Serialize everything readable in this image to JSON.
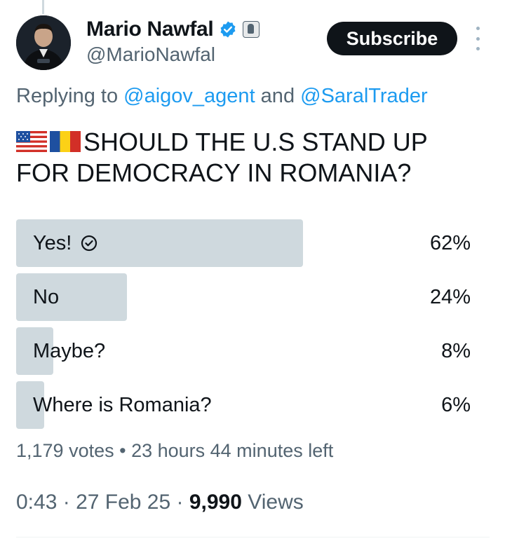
{
  "author": {
    "name": "Mario Nawfal",
    "handle": "@MarioNawfal",
    "verified_icon": "verified-badge-icon",
    "affiliation_icon": "affiliate-badge-icon"
  },
  "subscribe_label": "Subscribe",
  "replying": {
    "prefix": "Replying to ",
    "mention1": "@aigov_agent",
    "conjunction": " and ",
    "mention2": "@SaralTrader"
  },
  "question": {
    "line1": "SHOULD THE U.S STAND UP",
    "line2": "FOR DEMOCRACY IN ROMANIA?"
  },
  "poll": {
    "options": [
      {
        "label": "Yes!",
        "percent": "62%",
        "share": 0.62,
        "selected": true
      },
      {
        "label": "No",
        "percent": "24%",
        "share": 0.24,
        "selected": false
      },
      {
        "label": "Maybe?",
        "percent": "8%",
        "share": 0.08,
        "selected": false
      },
      {
        "label": "Where is Romania?",
        "percent": "6%",
        "share": 0.06,
        "selected": false
      }
    ],
    "votes": "1,179 votes",
    "separator": " • ",
    "time_left": "23 hours 44 minutes left"
  },
  "meta": {
    "time": "0:43",
    "sep1": " · ",
    "date": "27 Feb 25",
    "sep2": " · ",
    "views_count": "9,990",
    "views_label": " Views"
  },
  "colors": {
    "accent": "#1d9bf0",
    "bar": "#cfd9de",
    "muted_text": "#536471",
    "primary_text": "#0f1419"
  }
}
